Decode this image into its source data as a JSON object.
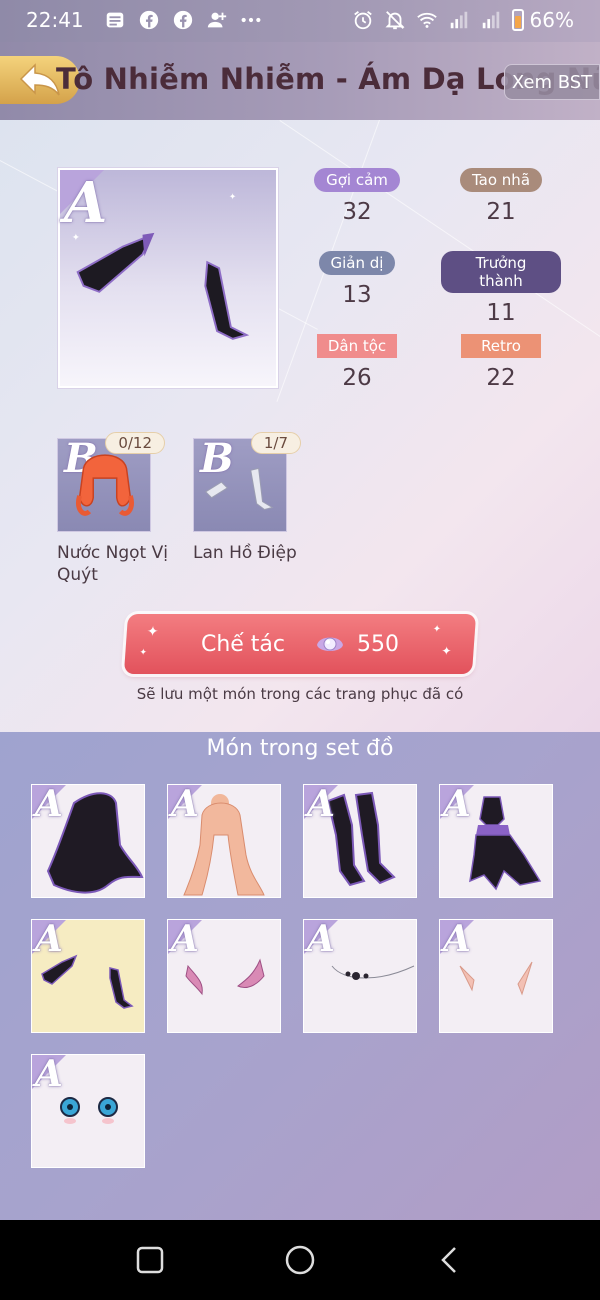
{
  "status_bar": {
    "time": "22:41",
    "battery": "66%",
    "battery_level": 0.66,
    "left_icons": [
      "message-icon",
      "facebook-icon",
      "facebook-icon",
      "add-contact-icon",
      "more-icon"
    ],
    "right_icons": [
      "alarm-icon",
      "mute-icon",
      "wifi-icon",
      "signal-icon",
      "signal-icon",
      "battery-icon"
    ]
  },
  "header": {
    "title": "Tô Nhiễm Nhiễm - Ám Dạ Long Nữ",
    "view_collection": "Xem BST",
    "back_icon": "back-arrow-icon"
  },
  "item": {
    "grade": "A",
    "stats": [
      {
        "label": "Gợi cảm",
        "value": "32",
        "color": "#a486d3"
      },
      {
        "label": "Tao nhã",
        "value": "21",
        "color": "#a98b7b"
      },
      {
        "label": "Giản dị",
        "value": "13",
        "color": "#7d87aa"
      },
      {
        "label": "Trưởng thành",
        "value": "11",
        "color": "#5e4f84"
      },
      {
        "label": "Dân tộc",
        "value": "26",
        "color": "#f08c8c"
      },
      {
        "label": "Retro",
        "value": "22",
        "color": "#ec9275"
      }
    ]
  },
  "materials": [
    {
      "grade": "B",
      "count": "0/12",
      "name": "Nước Ngọt Vị Quýt"
    },
    {
      "grade": "B",
      "count": "1/7",
      "name": "Lan Hồ Điệp"
    }
  ],
  "craft": {
    "label": "Chế tác",
    "cost": "550",
    "currency_icon": "pearl-icon",
    "hint": "Sẽ lưu một món trong các trang phục đã có"
  },
  "set": {
    "title": "Món trong set đồ",
    "items": [
      {
        "grade": "A",
        "name": "cloak"
      },
      {
        "grade": "A",
        "name": "hair"
      },
      {
        "grade": "A",
        "name": "boots"
      },
      {
        "grade": "A",
        "name": "dress"
      },
      {
        "grade": "A",
        "name": "gloves",
        "selected": true
      },
      {
        "grade": "A",
        "name": "horns"
      },
      {
        "grade": "A",
        "name": "necklace"
      },
      {
        "grade": "A",
        "name": "elf-ears"
      },
      {
        "grade": "A",
        "name": "eyes"
      }
    ]
  },
  "nav": {
    "icons": [
      "recent-apps-icon",
      "home-icon",
      "back-icon"
    ]
  }
}
